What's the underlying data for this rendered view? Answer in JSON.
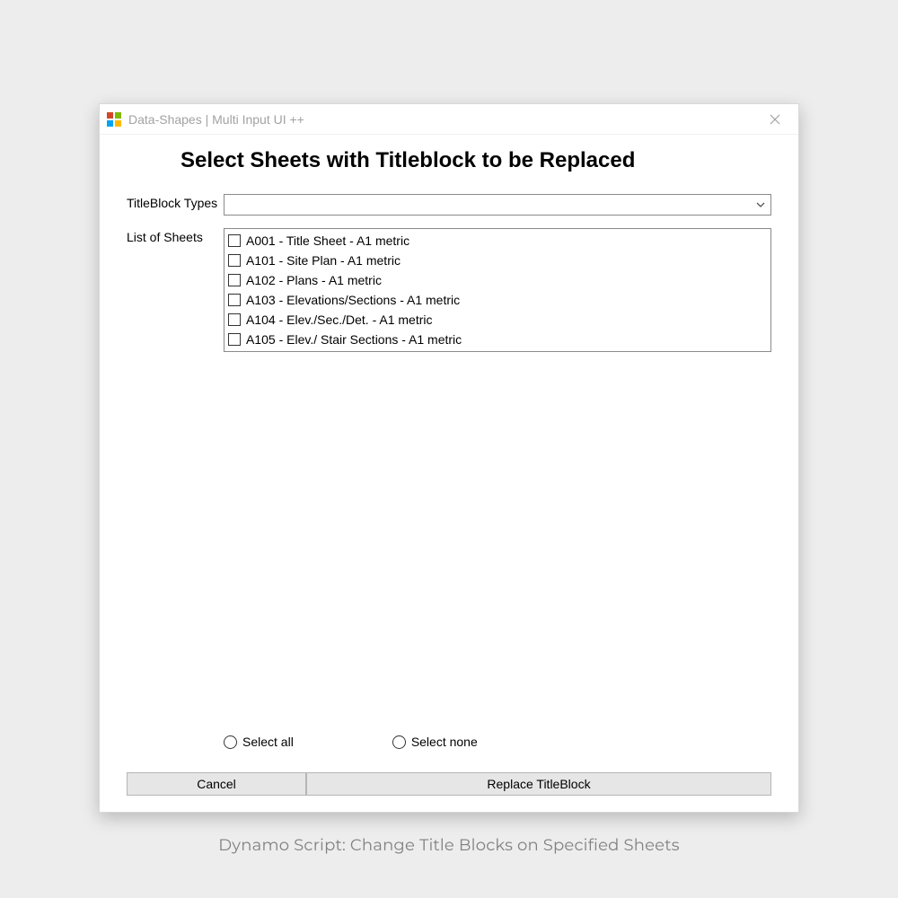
{
  "window": {
    "title": "Data-Shapes | Multi Input UI ++"
  },
  "heading": "Select Sheets with Titleblock to be Replaced",
  "fields": {
    "titleblock_label": "TitleBlock Types",
    "titleblock_value": "",
    "list_label": "List of Sheets"
  },
  "sheets": [
    {
      "label": "A001 - Title Sheet - A1 metric"
    },
    {
      "label": "A101 - Site Plan - A1 metric"
    },
    {
      "label": "A102 - Plans - A1 metric"
    },
    {
      "label": "A103 - Elevations/Sections - A1 metric"
    },
    {
      "label": "A104 - Elev./Sec./Det. - A1 metric"
    },
    {
      "label": "A105 - Elev./ Stair Sections - A1 metric"
    }
  ],
  "selection": {
    "select_all": "Select all",
    "select_none": "Select none"
  },
  "buttons": {
    "cancel": "Cancel",
    "primary": "Replace TitleBlock"
  },
  "caption": "Dynamo Script: Change Title Blocks on Specified Sheets"
}
